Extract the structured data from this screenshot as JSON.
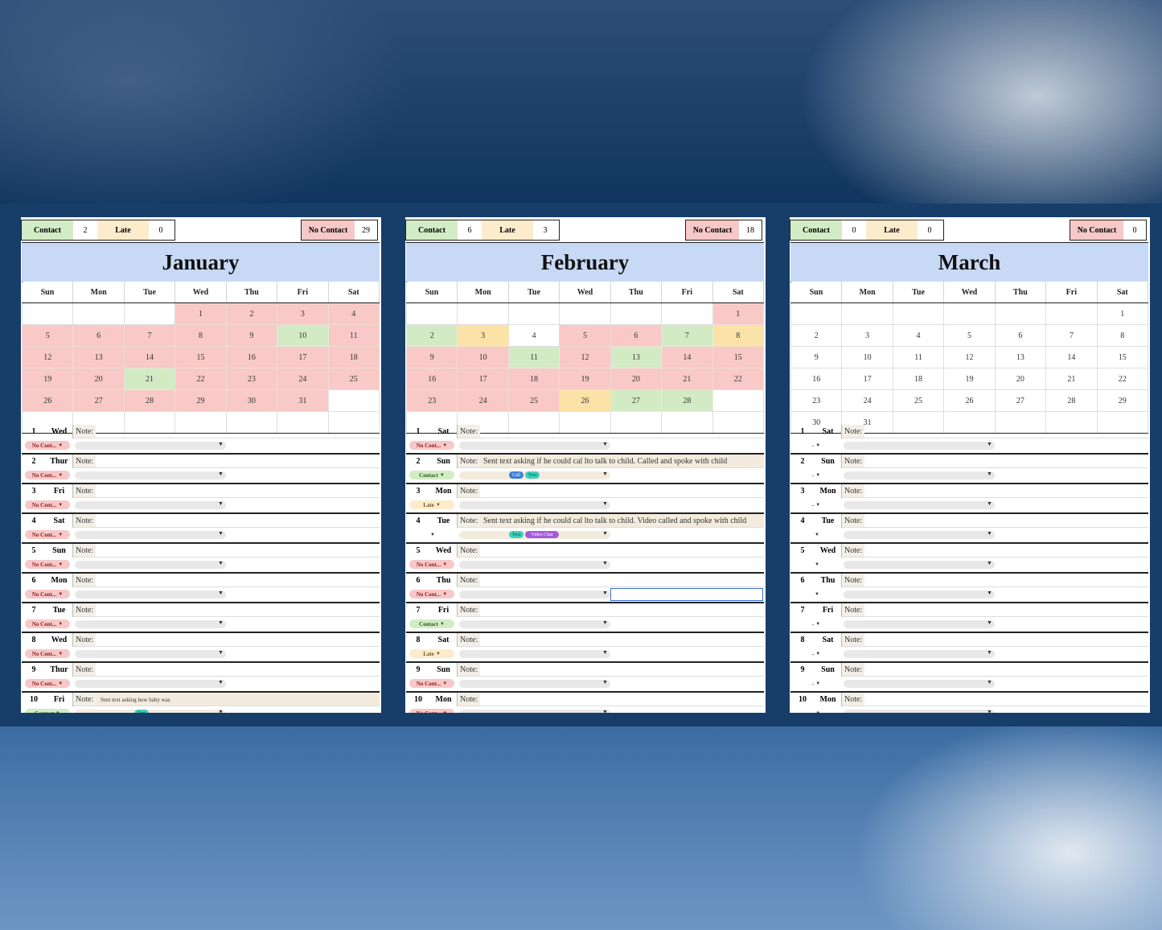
{
  "labels": {
    "contact": "Contact",
    "late": "Late",
    "no_contact": "No Contact",
    "note": "Note:"
  },
  "colors": {
    "contact": "#d2ecc5",
    "late": "#fdeccb",
    "no_contact": "#f7c8c8",
    "title_bar": "#c8d9f5",
    "background_band": "#173d69"
  },
  "weekdays": [
    "Sun",
    "Mon",
    "Tue",
    "Wed",
    "Thu",
    "Fri",
    "Sat"
  ],
  "months": [
    {
      "name": "January",
      "counts": {
        "contact": "2",
        "late": "0",
        "no_contact": "29"
      },
      "weeks": [
        [
          "",
          "",
          "",
          "1",
          "2",
          "3",
          "4"
        ],
        [
          "5",
          "6",
          "7",
          "8",
          "9",
          "10",
          "11"
        ],
        [
          "12",
          "13",
          "14",
          "15",
          "16",
          "17",
          "18"
        ],
        [
          "19",
          "20",
          "21",
          "22",
          "23",
          "24",
          "25"
        ],
        [
          "26",
          "27",
          "28",
          "29",
          "30",
          "31",
          ""
        ],
        [
          "",
          "",
          "",
          "",
          "",
          "",
          ""
        ]
      ],
      "day_status": {
        "1": "r",
        "2": "r",
        "3": "r",
        "4": "r",
        "5": "r",
        "6": "r",
        "7": "r",
        "8": "r",
        "9": "r",
        "10": "g",
        "11": "r",
        "12": "r",
        "13": "r",
        "14": "r",
        "15": "r",
        "16": "r",
        "17": "r",
        "18": "r",
        "19": "r",
        "20": "r",
        "21": "g",
        "22": "r",
        "23": "r",
        "24": "r",
        "25": "r",
        "26": "r",
        "27": "r",
        "28": "r",
        "29": "r",
        "30": "r",
        "31": "r"
      },
      "entries": [
        {
          "num": "1",
          "day": "Wed",
          "status": "No Cont...",
          "kind": "nc",
          "note": "",
          "tags": []
        },
        {
          "num": "2",
          "day": "Thur",
          "status": "No Cont...",
          "kind": "nc",
          "note": "",
          "tags": []
        },
        {
          "num": "3",
          "day": "Fri",
          "status": "No Cont...",
          "kind": "nc",
          "note": "",
          "tags": []
        },
        {
          "num": "4",
          "day": "Sat",
          "status": "No Cont...",
          "kind": "nc",
          "note": "",
          "tags": []
        },
        {
          "num": "5",
          "day": "Sun",
          "status": "No Cont...",
          "kind": "nc",
          "note": "",
          "tags": []
        },
        {
          "num": "6",
          "day": "Mon",
          "status": "No Cont...",
          "kind": "nc",
          "note": "",
          "tags": []
        },
        {
          "num": "7",
          "day": "Tue",
          "status": "No Cont...",
          "kind": "nc",
          "note": "",
          "tags": []
        },
        {
          "num": "8",
          "day": "Wed",
          "status": "No Cont...",
          "kind": "nc",
          "note": "",
          "tags": []
        },
        {
          "num": "9",
          "day": "Thur",
          "status": "No Cont...",
          "kind": "nc",
          "note": "",
          "tags": []
        },
        {
          "num": "10",
          "day": "Fri",
          "status": "Contact",
          "kind": "ct",
          "note": "Sent text asking how baby was",
          "tags": [
            "Text"
          ]
        }
      ]
    },
    {
      "name": "February",
      "counts": {
        "contact": "6",
        "late": "3",
        "no_contact": "18"
      },
      "weeks": [
        [
          "",
          "",
          "",
          "",
          "",
          "",
          "1"
        ],
        [
          "2",
          "3",
          "4",
          "5",
          "6",
          "7",
          "8"
        ],
        [
          "9",
          "10",
          "11",
          "12",
          "13",
          "14",
          "15"
        ],
        [
          "16",
          "17",
          "18",
          "19",
          "20",
          "21",
          "22"
        ],
        [
          "23",
          "24",
          "25",
          "26",
          "27",
          "28",
          ""
        ],
        [
          "",
          "",
          "",
          "",
          "",
          "",
          ""
        ]
      ],
      "day_status": {
        "1": "r",
        "2": "g",
        "3": "y",
        "4": "",
        "5": "r",
        "6": "r",
        "7": "g",
        "8": "y",
        "9": "r",
        "10": "r",
        "11": "g",
        "12": "r",
        "13": "g",
        "14": "r",
        "15": "r",
        "16": "r",
        "17": "r",
        "18": "r",
        "19": "r",
        "20": "r",
        "21": "r",
        "22": "r",
        "23": "r",
        "24": "r",
        "25": "r",
        "26": "y",
        "27": "g",
        "28": "g"
      },
      "entries": [
        {
          "num": "1",
          "day": "Sat",
          "status": "No Cont...",
          "kind": "nc",
          "note": "",
          "tags": []
        },
        {
          "num": "2",
          "day": "Sun",
          "status": "Contact",
          "kind": "ct",
          "note": "Sent text asking if he could cal lto talk to child. Called and spoke with child",
          "tags": [
            "Call",
            "Text"
          ]
        },
        {
          "num": "3",
          "day": "Mon",
          "status": "Late",
          "kind": "lt",
          "note": "",
          "tags": []
        },
        {
          "num": "4",
          "day": "Tue",
          "status": "",
          "kind": "none",
          "note": "Sent text asking if he could cal lto talk to child. Video called and spoke with child",
          "tags": [
            "Text",
            "Video Chat"
          ]
        },
        {
          "num": "5",
          "day": "Wed",
          "status": "No Cont...",
          "kind": "nc",
          "note": "",
          "tags": []
        },
        {
          "num": "6",
          "day": "Thu",
          "status": "No Cont...",
          "kind": "nc",
          "note": "",
          "tags": []
        },
        {
          "num": "7",
          "day": "Fri",
          "status": "Contact",
          "kind": "ct",
          "note": "",
          "tags": []
        },
        {
          "num": "8",
          "day": "Sat",
          "status": "Late",
          "kind": "lt",
          "note": "",
          "tags": []
        },
        {
          "num": "9",
          "day": "Sun",
          "status": "No Cont...",
          "kind": "nc",
          "note": "",
          "tags": []
        },
        {
          "num": "10",
          "day": "Mon",
          "status": "No Cont...",
          "kind": "nc",
          "note": "",
          "tags": []
        }
      ]
    },
    {
      "name": "March",
      "counts": {
        "contact": "0",
        "late": "0",
        "no_contact": "0"
      },
      "weeks": [
        [
          "",
          "",
          "",
          "",
          "",
          "",
          "1"
        ],
        [
          "2",
          "3",
          "4",
          "5",
          "6",
          "7",
          "8"
        ],
        [
          "9",
          "10",
          "11",
          "12",
          "13",
          "14",
          "15"
        ],
        [
          "16",
          "17",
          "18",
          "19",
          "20",
          "21",
          "22"
        ],
        [
          "23",
          "24",
          "25",
          "26",
          "27",
          "28",
          "29"
        ],
        [
          "30",
          "31",
          "",
          "",
          "",
          "",
          ""
        ]
      ],
      "day_status": {},
      "entries": [
        {
          "num": "1",
          "day": "Sat",
          "status": "-",
          "kind": "none",
          "note": "",
          "tags": []
        },
        {
          "num": "2",
          "day": "Sun",
          "status": "-",
          "kind": "none",
          "note": "",
          "tags": []
        },
        {
          "num": "3",
          "day": "Mon",
          "status": "-",
          "kind": "none",
          "note": "",
          "tags": []
        },
        {
          "num": "4",
          "day": "Tue",
          "status": "",
          "kind": "none",
          "note": "",
          "tags": []
        },
        {
          "num": "5",
          "day": "Wed",
          "status": "",
          "kind": "none",
          "note": "",
          "tags": []
        },
        {
          "num": "6",
          "day": "Thu",
          "status": "",
          "kind": "none",
          "note": "",
          "tags": []
        },
        {
          "num": "7",
          "day": "Fri",
          "status": "-",
          "kind": "none",
          "note": "",
          "tags": []
        },
        {
          "num": "8",
          "day": "Sat",
          "status": "-",
          "kind": "none",
          "note": "",
          "tags": []
        },
        {
          "num": "9",
          "day": "Sun",
          "status": "-",
          "kind": "none",
          "note": "",
          "tags": []
        },
        {
          "num": "10",
          "day": "Mon",
          "status": "-",
          "kind": "none",
          "note": "",
          "tags": []
        }
      ]
    }
  ]
}
